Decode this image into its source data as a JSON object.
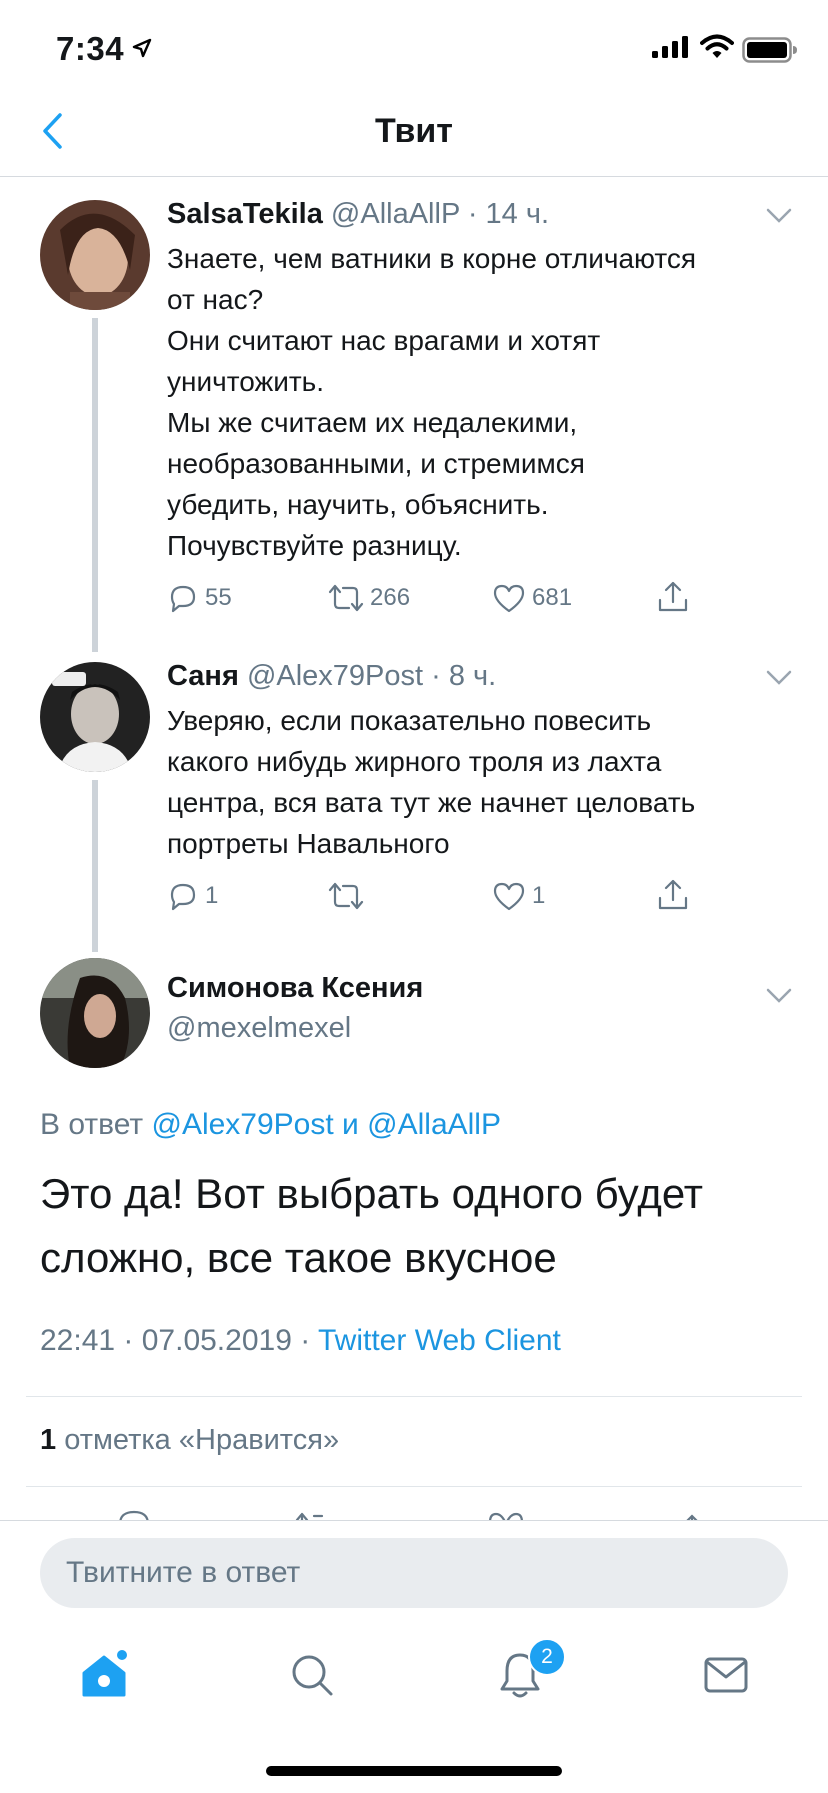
{
  "status_bar": {
    "time": "7:34"
  },
  "nav": {
    "title": "Твит"
  },
  "tweets": [
    {
      "name": "SalsaTekila",
      "handle": "@AllaAllP",
      "time": "· 14 ч.",
      "lines": [
        "Знаете, чем ватники в корне отличаются",
        "от нас?",
        "Они считают нас врагами и хотят",
        "уничтожить.",
        "Мы же считаем их недалекими,",
        "необразованными,  и стремимся",
        "убедить, научить, объяснить.",
        "Почувствуйте разницу."
      ],
      "replies": "55",
      "retweets": "266",
      "likes": "681"
    },
    {
      "name": "Саня",
      "handle": "@Alex79Post",
      "time": "· 8 ч.",
      "lines": [
        "Уверяю, если показательно повесить",
        "какого нибудь жирного троля из лахта",
        "центра, вся вата тут же начнет целовать",
        "портреты Навального"
      ],
      "replies": "1",
      "retweets": "",
      "likes": "1"
    }
  ],
  "main_tweet": {
    "name": "Симонова Ксения",
    "handle": "@mexelmexel",
    "reply_prefix": "В ответ",
    "reply_user1": "@Alex79Post",
    "reply_and": "и",
    "reply_user2": "@AllaAllP",
    "text_line1": "Это да! Вот выбрать одного будет",
    "text_line2": "сложно, все такое вкусное",
    "timestamp": "22:41 · 07.05.2019 ·",
    "client": "Twitter Web Client",
    "like_count": "1",
    "like_label": "отметка «Нравится»"
  },
  "reply_input": {
    "placeholder": "Твитните в ответ"
  },
  "tab_bar": {
    "notifications_badge": "2"
  },
  "colors": {
    "accent": "#1da1f2",
    "link": "#1b95e0",
    "muted": "#657786",
    "text": "#14171a"
  }
}
